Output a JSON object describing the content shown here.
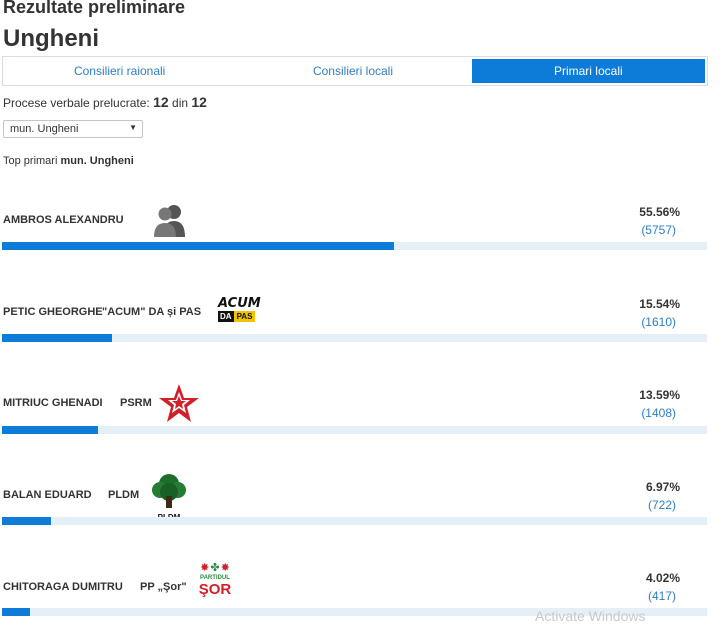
{
  "header": {
    "title": "Rezultate preliminare",
    "city": "Ungheni"
  },
  "tabs": [
    {
      "label": "Consilieri raionali",
      "active": false
    },
    {
      "label": "Consilieri locali",
      "active": false
    },
    {
      "label": "Primari locali",
      "active": true
    }
  ],
  "processed": {
    "label": "Procese verbale prelucrate:",
    "done": "12",
    "sep": "din",
    "total": "12"
  },
  "locality_select": {
    "value": "mun. Ungheni"
  },
  "top_label": {
    "prefix": "Top primari",
    "locality": "mun. Ungheni"
  },
  "colors": {
    "accent": "#0d7bd8",
    "bar_track": "#e5eff8",
    "link": "#2f7dc1"
  },
  "candidates": [
    {
      "name": "AMBROS ALEXANDRU",
      "party": "",
      "logo": "independent-silhouette-icon",
      "percent": "55.56%",
      "votes": "(5757)",
      "share": 55.56
    },
    {
      "name": "PETIC GHEORGHE",
      "party": "\"ACUM\" DA și PAS",
      "logo": "acum-logo",
      "logo_text_top": "ACUM",
      "logo_text_left": "DA",
      "logo_text_right": "PAS",
      "percent": "15.54%",
      "votes": "(1610)",
      "share": 15.54
    },
    {
      "name": "MITRIUC GHENADI",
      "party": "PSRM",
      "logo": "psrm-star-logo",
      "percent": "13.59%",
      "votes": "(1408)",
      "share": 13.59
    },
    {
      "name": "BALAN EDUARD",
      "party": "PLDM",
      "logo": "pldm-tree-logo",
      "logo_text": "PLDM",
      "percent": "6.97%",
      "votes": "(722)",
      "share": 6.97
    },
    {
      "name": "CHITORAGA DUMITRU",
      "party": "PP „Şor\"",
      "logo": "sor-logo",
      "logo_text_top": "PARTIDUL",
      "logo_text_bottom": "ŞOR",
      "percent": "4.02%",
      "votes": "(417)",
      "share": 4.02
    }
  ],
  "watermark": "Activate Windows"
}
